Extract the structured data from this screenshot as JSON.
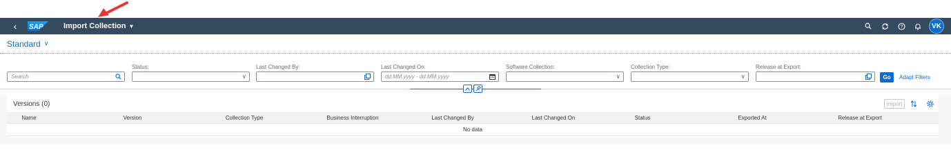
{
  "shell": {
    "logo_text": "SAP",
    "title": "Import Collection",
    "user_initials": "VK",
    "colors": {
      "bar": "#354a5f",
      "accent": "#0a6ed1",
      "annotation_arrow": "#e53935"
    },
    "icons": [
      "back-icon",
      "search-icon",
      "sync-icon",
      "help-icon",
      "bell-icon"
    ]
  },
  "variant": {
    "label": "Standard"
  },
  "filters": {
    "search": {
      "placeholder": "Search",
      "value": ""
    },
    "status": {
      "label": "Status:",
      "value": ""
    },
    "last_changed_by": {
      "label": "Last Changed By:",
      "value": ""
    },
    "last_changed_on": {
      "label": "Last Changed On:",
      "placeholder": "dd.MM.yyyy - dd.MM.yyyy"
    },
    "software_collection": {
      "label": "Software Collection:",
      "value": ""
    },
    "collection_type": {
      "label": "Collection Type:",
      "value": ""
    },
    "release_at_export": {
      "label": "Release at Export:",
      "value": ""
    },
    "go_label": "Go",
    "adapt_label": "Adapt Filters"
  },
  "table": {
    "title": "Versions (0)",
    "import_label": "Import",
    "columns": [
      "Name",
      "Version",
      "Collection Type",
      "Business Interruption",
      "Last Changed By",
      "Last Changed On",
      "Status",
      "Exported At",
      "Release at Export"
    ],
    "empty_text": "No data"
  }
}
